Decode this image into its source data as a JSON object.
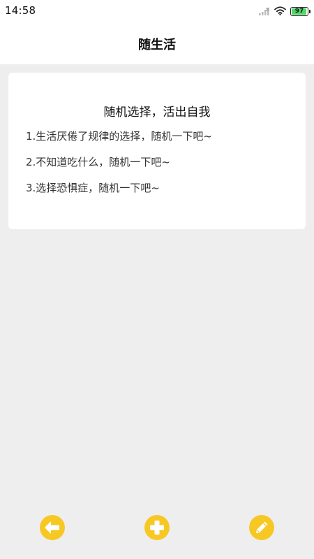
{
  "status_bar": {
    "time": "14:58",
    "battery_level": "97",
    "icons": [
      "signal-icon",
      "wifi-icon",
      "battery-icon"
    ]
  },
  "app_bar": {
    "title": "随生活"
  },
  "card": {
    "heading": "随机选择，活出自我",
    "items": [
      "1.生活厌倦了规律的选择，随机一下吧~",
      "2.不知道吃什么，随机一下吧~",
      "3.选择恐惧症，随机一下吧~"
    ]
  },
  "bottom_bar": {
    "buttons": [
      "back-arrow-icon",
      "plus-icon",
      "pencil-icon"
    ]
  },
  "colors": {
    "accent": "#f7c823",
    "background": "#eeeeee",
    "surface": "#ffffff",
    "battery": "#4cd964"
  }
}
